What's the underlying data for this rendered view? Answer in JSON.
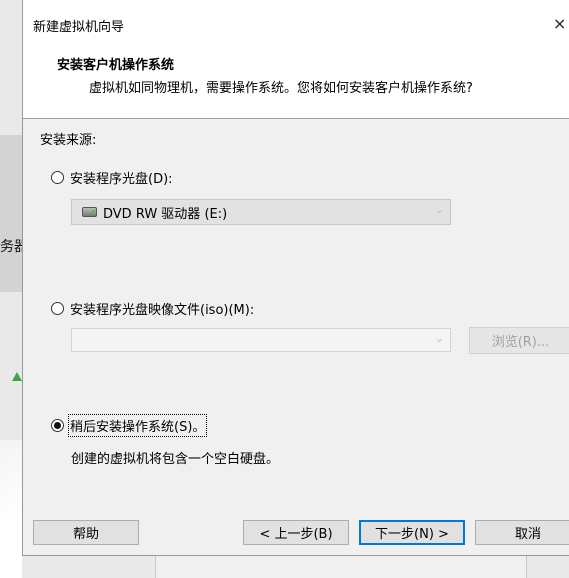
{
  "background": {
    "partial_text": "务器"
  },
  "dialog": {
    "title": "新建虚拟机向导",
    "close_glyph": "×",
    "header": {
      "title": "安装客户机操作系统",
      "subtitle": "虚拟机如同物理机，需要操作系统。您将如何安装客户机操作系统?"
    },
    "source_label": "安装来源:",
    "options": {
      "disc": {
        "label": "安装程序光盘(D):",
        "checked": false
      },
      "disc_drive": {
        "value": "DVD RW 驱动器 (E:)",
        "icon": "dvd-drive-icon"
      },
      "iso": {
        "label": "安装程序光盘映像文件(iso)(M):",
        "checked": false
      },
      "iso_path": {
        "value": ""
      },
      "browse": "浏览(R)...",
      "later": {
        "label": "稍后安装操作系统(S)。",
        "checked": true
      }
    },
    "later_description": "创建的虚拟机将包含一个空白硬盘。",
    "buttons": {
      "help": "帮助",
      "back": "< 上一步(B)",
      "next": "下一步(N) >",
      "cancel": "取消"
    }
  }
}
